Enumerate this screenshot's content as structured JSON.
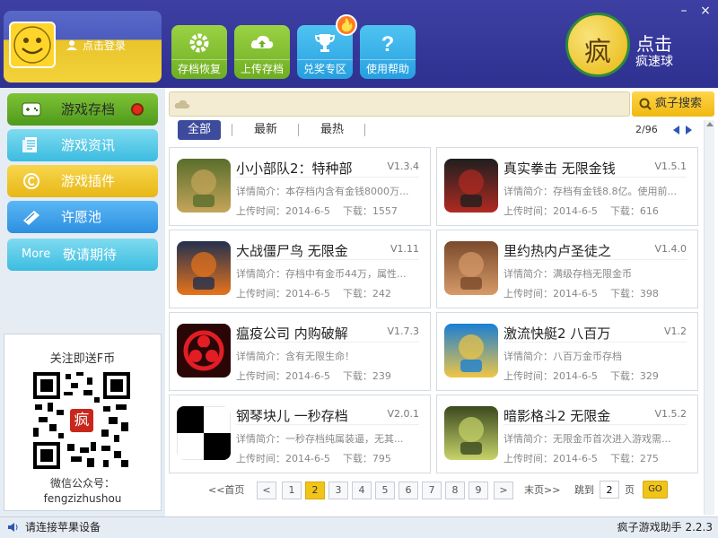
{
  "window": {
    "minimize": "–",
    "close": "×"
  },
  "user": {
    "login_label": "点击登录"
  },
  "nav": [
    {
      "label": "存档恢复",
      "icon": "gear-icon"
    },
    {
      "label": "上传存档",
      "icon": "cloud-upload-icon"
    },
    {
      "label": "兑奖专区",
      "icon": "trophy-icon"
    },
    {
      "label": "使用帮助",
      "icon": "question-icon"
    }
  ],
  "speed_ball": {
    "logo": "疯",
    "line1": "点击",
    "line2": "疯速球"
  },
  "sidebar": {
    "items": [
      {
        "label": "游戏存档",
        "icon": "gamepad-icon"
      },
      {
        "label": "游戏资讯",
        "icon": "news-icon"
      },
      {
        "label": "游戏插件",
        "icon": "plugin-icon"
      },
      {
        "label": "许愿池",
        "icon": "wish-icon"
      },
      {
        "label": "敬请期待",
        "tag": "More"
      }
    ],
    "qr": {
      "top_text": "关注即送F币",
      "bottom_line1": "微信公众号：",
      "bottom_line2": "fengzizhushou",
      "center_logo": "疯"
    }
  },
  "search": {
    "placeholder": "",
    "button_label": "疯子搜索"
  },
  "filters": {
    "tabs": [
      "全部",
      "最新",
      "最热"
    ],
    "page_indicator": "2/96"
  },
  "cards": [
    {
      "title": "小小部队2：特种部",
      "version": "V1.3.4",
      "desc": "详情简介：本存档内含有金钱8000万...",
      "upload": "上传时间：2014-6-5",
      "downloads": "下载：1557",
      "thumb": "soldier-thumb",
      "c1": "#5a6e2c",
      "c2": "#c5a55a"
    },
    {
      "title": "真实拳击 无限金钱",
      "version": "V1.5.1",
      "desc": "详情简介：存档有金钱8.8亿。使用前...",
      "upload": "上传时间：2014-6-5",
      "downloads": "下载：616",
      "thumb": "boxing-thumb",
      "c1": "#1f1f1f",
      "c2": "#b02a22"
    },
    {
      "title": "大战僵尸鸟 无限金",
      "version": "V1.11",
      "desc": "详情简介：存档中有金币44万，属性...",
      "upload": "上传时间：2014-6-5",
      "downloads": "下载：242",
      "thumb": "pumpkin-thumb",
      "c1": "#23304f",
      "c2": "#e7741b"
    },
    {
      "title": "里约热内卢圣徒之",
      "version": "V1.4.0",
      "desc": "详情简介：满级存档无限金币",
      "upload": "上传时间：2014-6-5",
      "downloads": "下载：398",
      "thumb": "masked-thumb",
      "c1": "#7a4a2c",
      "c2": "#d79a68"
    },
    {
      "title": "瘟疫公司 内购破解",
      "version": "V1.7.3",
      "desc": "详情简介：含有无限生命！",
      "upload": "上传时间：2014-6-5",
      "downloads": "下载：239",
      "thumb": "biohazard-thumb",
      "c1": "#2a0607",
      "c2": "#e21d24"
    },
    {
      "title": "激流快艇2 八百万",
      "version": "V1.2",
      "desc": "详情简介：八百万金币存档",
      "upload": "上传时间：2014-6-5",
      "downloads": "下载：329",
      "thumb": "boat-thumb",
      "c1": "#1a7fd4",
      "c2": "#f0c545"
    },
    {
      "title": "钢琴块儿 一秒存档",
      "version": "V2.0.1",
      "desc": "详情简介：一秒存档纯属装逼，无其...",
      "upload": "上传时间：2014-6-5",
      "downloads": "下载：795",
      "thumb": "piano-thumb",
      "c1": "#000000",
      "c2": "#ffffff"
    },
    {
      "title": "暗影格斗2 无限金",
      "version": "V1.5.2",
      "desc": "详情简介：无限金币首次进入游戏需...",
      "upload": "上传时间：2014-6-5",
      "downloads": "下载：275",
      "thumb": "shadow-thumb",
      "c1": "#3b4a20",
      "c2": "#c8d36a"
    }
  ],
  "pager": {
    "first": "<<首页",
    "prev": "<",
    "pages": [
      "1",
      "2",
      "3",
      "4",
      "5",
      "6",
      "7",
      "8",
      "9"
    ],
    "current": "2",
    "next": ">",
    "last": "末页>>",
    "jump_label": "跳到",
    "jump_value": "2",
    "page_suffix": "页",
    "go": "GO"
  },
  "status": {
    "left": "请连接苹果设备",
    "right": "疯子游戏助手 2.2.3"
  }
}
